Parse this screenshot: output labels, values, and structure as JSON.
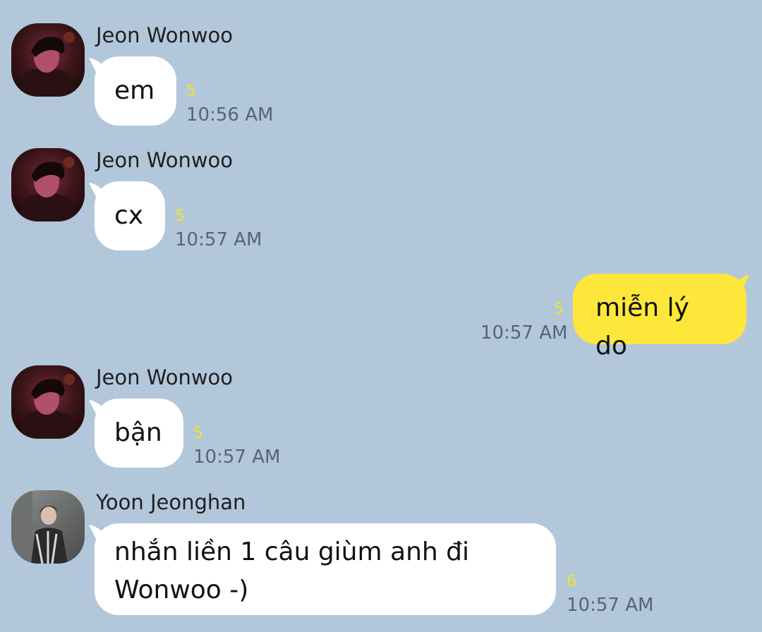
{
  "messages": [
    {
      "sender": "Jeon Wonwoo",
      "text": "em",
      "unread": "5",
      "time": "10:56 AM"
    },
    {
      "sender": "Jeon Wonwoo",
      "text": "cx",
      "unread": "5",
      "time": "10:57 AM"
    },
    {
      "sender": "",
      "text": "miễn lý do",
      "unread": "5",
      "time": "10:57 AM"
    },
    {
      "sender": "Jeon Wonwoo",
      "text": "bận",
      "unread": "5",
      "time": "10:57 AM"
    },
    {
      "sender": "Yoon Jeonghan",
      "text": "nhắn liền 1 câu giùm anh đi\nWonwoo -)",
      "unread": "6",
      "time": "10:57 AM"
    }
  ]
}
